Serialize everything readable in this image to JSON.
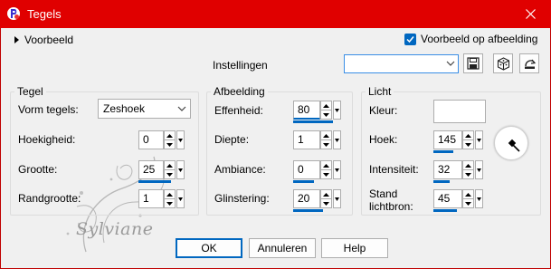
{
  "window": {
    "title": "Tegels"
  },
  "top": {
    "preview_label": "Voorbeeld",
    "preview_on_image_label": "Voorbeeld op afbeelding",
    "preview_on_image_checked": true,
    "settings_label": "Instellingen",
    "settings_value": ""
  },
  "tegel": {
    "legend": "Tegel",
    "shape_label": "Vorm tegels:",
    "shape_value": "Zeshoek",
    "angularity_label": "Hoekigheid:",
    "angularity_value": "0",
    "size_label": "Grootte:",
    "size_value": "25",
    "border_label": "Randgrootte:",
    "border_value": "1"
  },
  "afbeelding": {
    "legend": "Afbeelding",
    "smoothness_label": "Effenheid:",
    "smoothness_value": "80",
    "depth_label": "Diepte:",
    "depth_value": "1",
    "ambience_label": "Ambiance:",
    "ambience_value": "0",
    "shininess_label": "Glinstering:",
    "shininess_value": "20"
  },
  "licht": {
    "legend": "Licht",
    "color_label": "Kleur:",
    "color_value": "#ffffff",
    "angle_label": "Hoek:",
    "angle_value": "145",
    "intensity_label": "Intensiteit:",
    "intensity_value": "32",
    "elevation_label_1": "Stand",
    "elevation_label_2": "lichtbron:",
    "elevation_value": "45"
  },
  "watermark": {
    "text": "Sylviane"
  },
  "buttons": {
    "ok": "OK",
    "cancel": "Annuleren",
    "help": "Help"
  },
  "colors": {
    "titlebar": "#e00000",
    "accent": "#0067c0",
    "background": "#f0f0f0"
  }
}
